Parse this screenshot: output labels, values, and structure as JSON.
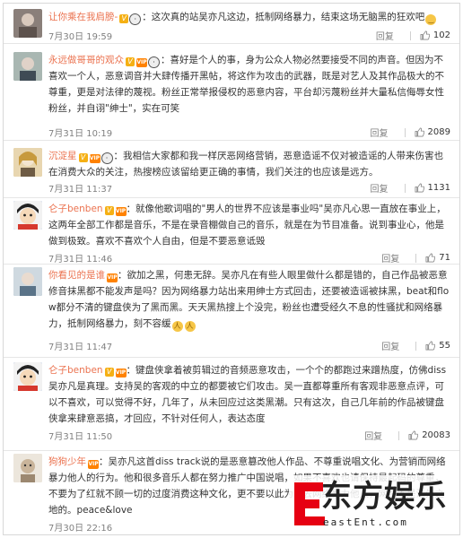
{
  "reply_label": "回复",
  "comments": [
    {
      "username": "让你乘在我肩膀-",
      "text": "：这次真的站吴亦凡这边，抵制网络暴力，结束这场无脑黑的狂欢吧",
      "time": "7月30日 19:59",
      "likes": "102",
      "avatar_color": "#8a7f7a"
    },
    {
      "username": "永远做哥哥的观众",
      "text": "：喜好是个人的事，身为公众人物必然要接受不同的声音。但因为不喜欢一个人，恶意调音并大肆传播开黑帖，将这作为攻击的武器，既是对艺人及其作品极大的不尊重，更是对法律的蔑视。粉丝正常举报侵权的恶意内容，平台却污蔑粉丝并大量私信侮辱女性粉丝，并自诩\"绅士\"，实在可笑",
      "time": "7月31日 10:19",
      "likes": "2089",
      "avatar_color": "#7b8a8f"
    },
    {
      "username": "沉淀星",
      "text": "：我相信大家都和我一样厌恶网络营销，恶意造谣不仅对被造谣的人带来伤害也在消费大众的关注，热搜榜应该留给更正确的事情，我们关注的也应该是远方。",
      "time": "7月31日 11:37",
      "likes": "1131",
      "avatar_color": "#c9a66b"
    },
    {
      "username": "仑子benben",
      "text": "：就像他歌词唱的\"男人的世界不应该是事业吗\"吴亦凡心思一直放在事业上，这两年全部工作都是音乐，不是在录音棚做自己的音乐，就是在为节目准备。说到事业心，他是做到极致。喜欢不喜欢个人自由，但是不要恶意诋毁",
      "time": "7月31日 11:46",
      "likes": "71",
      "avatar_color": "#3a6bc4"
    },
    {
      "username": "你看见的是谁",
      "text": "：欲加之黑，何患无辞。吴亦凡在有些人眼里做什么都是错的，自己作品被恶意修音抹黑都不能发声是吗？因为网络暴力站出来用绅士方式回击，还要被造谣被抹黑，beat和flow都分不清的键盘侠为了黑而黑。天天黑热搜上个没完，粉丝也遭受经久不息的性骚扰和网络暴力，抵制网络暴力，刻不容缓",
      "time": "7月31日 11:47",
      "likes": "55",
      "avatar_color": "#6f8fa8"
    },
    {
      "username": "仑子benben",
      "text": "：键盘侠拿着被剪辑过的音频恶意攻击，一个个的都跑过来蹭热度，仿佛diss吴亦凡是真理。支持吴的客观的中立的都要被它们攻击。吴一直都尊重所有客观非恶意点评，可以不喜欢，可以觉得不好，几年了，从未回应过这类黑潮。只有这次，自己几年前的作品被键盘侠拿来肆意恶搞，才回应，不针对任何人，表达态度",
      "time": "7月31日 11:50",
      "likes": "20083",
      "avatar_color": "#3a6bc4"
    },
    {
      "username": "狗狗少年",
      "text": "：吴亦凡这首diss track说的是恶意篡改他人作品、不尊重说唱文化、为营销而网络暴力他人的行为。他和很多音乐人都在努力推广中国说唱，如果不喜欢也请保持最起码的尊重，不要为了红就不顾一切的过度消费这种文化，更不要以此为由去网络暴力他人，网络不是法外之地的。peace&love",
      "time": "7月30日 22:16",
      "likes": "",
      "avatar_color": "#d9cfc2"
    }
  ],
  "watermark": {
    "title": "东方娱乐",
    "subtitle": "eastEnt.com"
  }
}
